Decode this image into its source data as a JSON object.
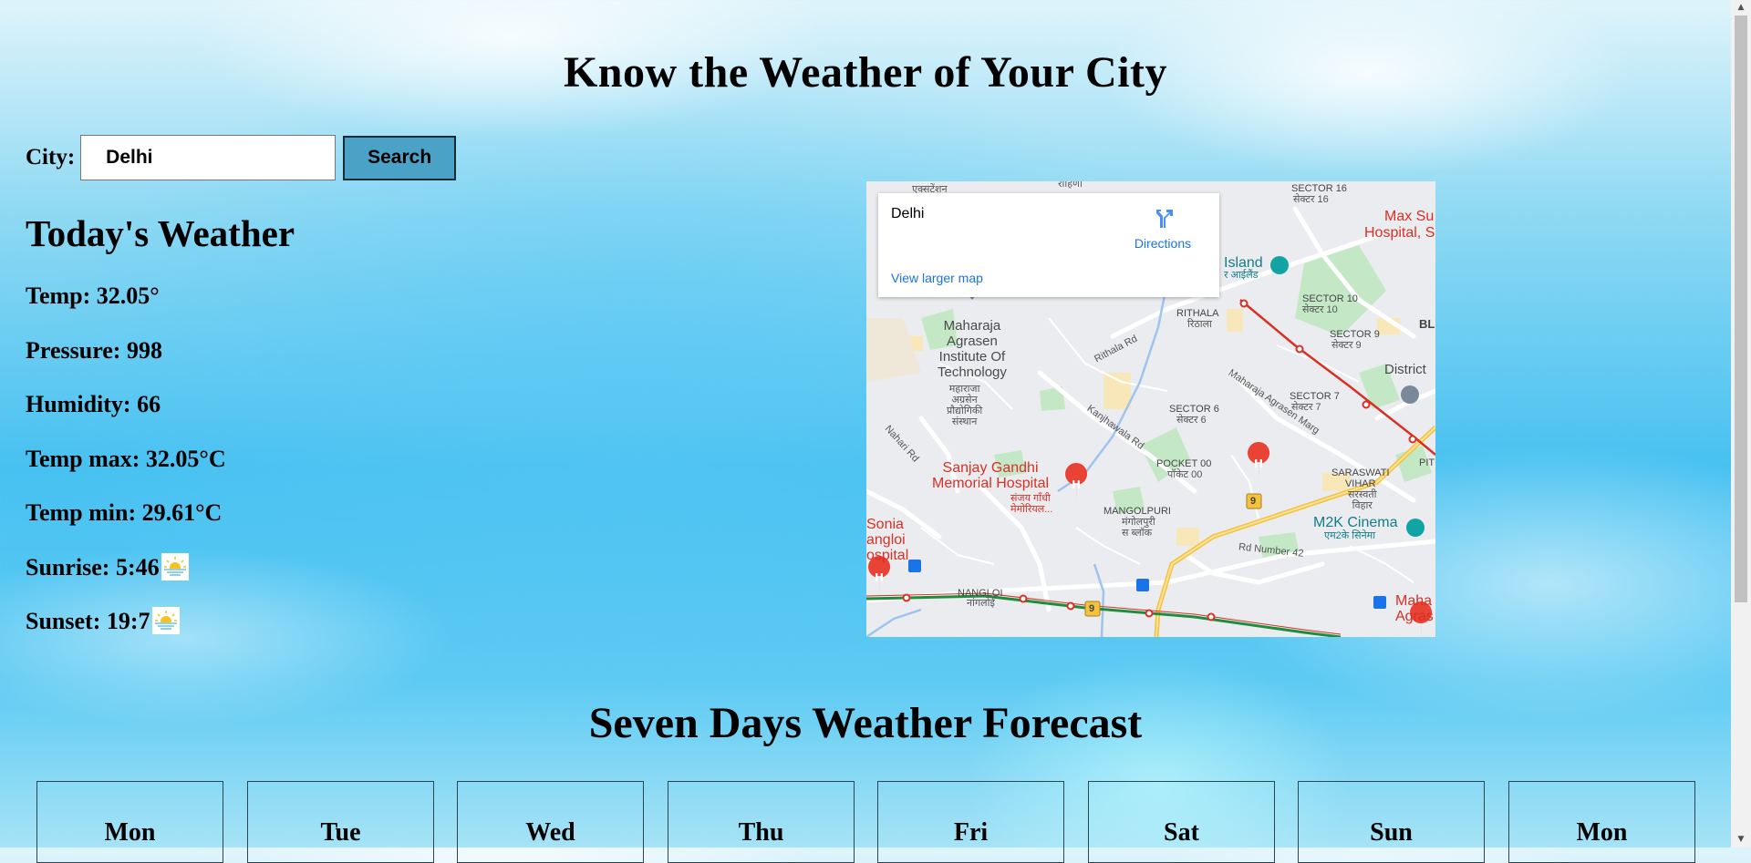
{
  "page": {
    "title": "Know the Weather of Your City"
  },
  "form": {
    "city_label": "City:",
    "city_value": "Delhi",
    "search_label": "Search"
  },
  "today": {
    "heading": "Today's Weather",
    "temp": "Temp: 32.05°",
    "pressure": "Pressure: 998",
    "humidity": "Humidity: 66",
    "temp_max": "Temp max: 32.05°C",
    "temp_min": "Temp min: 29.61°C",
    "sunrise": "Sunrise: 5:46",
    "sunset": "Sunset: 19:7",
    "sunrise_icon": "sunrise-icon",
    "sunset_icon": "sunset-icon"
  },
  "map": {
    "place_name": "Delhi",
    "directions_label": "Directions",
    "larger_map_label": "View larger map",
    "labels": {
      "top_left": "एक्सटेंशन",
      "top_mid": "रोहिणी",
      "sector16_en": "SECTOR 16",
      "sector16_hi": "सेक्टर 16",
      "maxsu": "Max Su",
      "hospital_s": "Hospital, S",
      "island": "Island",
      "island_hi": "र आईलैंड",
      "sector10_en": "SECTOR 10",
      "sector10_hi": "सेक्टर 10",
      "rithala_en": "RITHALA",
      "rithala_hi": "रिठाला",
      "maharaja_en": "Maharaja\nAgrasen\nInstitute Of\nTechnology",
      "maharaja_hi": "महाराजा\nअग्रसेन\nप्रौद्योगिकी\nसंस्थान",
      "rithala_rd": "Rithala Rd",
      "sector9_en": "SECTOR 9",
      "sector9_hi": "सेक्टर 9",
      "bl": "BL",
      "district": "District",
      "sector7_en": "SECTOR 7",
      "sector7_hi": "सेक्टर 7",
      "sector6_en": "SECTOR 6",
      "sector6_hi": "सेक्टर 6",
      "agrasen_marg": "Maharaja Agrasen Marg",
      "kanjhawala": "Kanjhawala Rd",
      "nahari": "Nahari Rd",
      "sanjay_en": "Sanjay Gandhi\nMemorial Hospital",
      "sanjay_hi": "संजय गाँधी\nमेमोरियल...",
      "pocket_en": "POCKET 00",
      "pocket_hi": "पॉकेट 00",
      "saraswati_en": "SARASWATI\nVIHAR",
      "saraswati_hi": "सरस्वती\nविहार",
      "pit": "PIT",
      "mangolpuri_en": "MANGOLPURI",
      "mangolpuri_hi": "मंगोलपुरी\nस ब्लॉक",
      "m2k_en": "M2K Cinema",
      "m2k_hi": "एम2के सिनेमा",
      "sonia": "Sonia\nangloi\nospital",
      "rd42": "Rd Number 42",
      "nangloi_en": "NANGLOI",
      "nangloi_hi": "नांगलोई",
      "maha": "Maha",
      "agras": "Agras",
      "route9": "9"
    }
  },
  "forecast": {
    "heading": "Seven Days Weather Forecast",
    "days": [
      "Mon",
      "Tue",
      "Wed",
      "Thu",
      "Fri",
      "Sat",
      "Sun",
      "Mon"
    ]
  },
  "colors": {
    "search_button": "#4aa3c6",
    "link_blue": "#1a73e8",
    "hospital_red": "#e94335",
    "metro_red": "#d93025",
    "metro_green": "#1e8e3e"
  }
}
